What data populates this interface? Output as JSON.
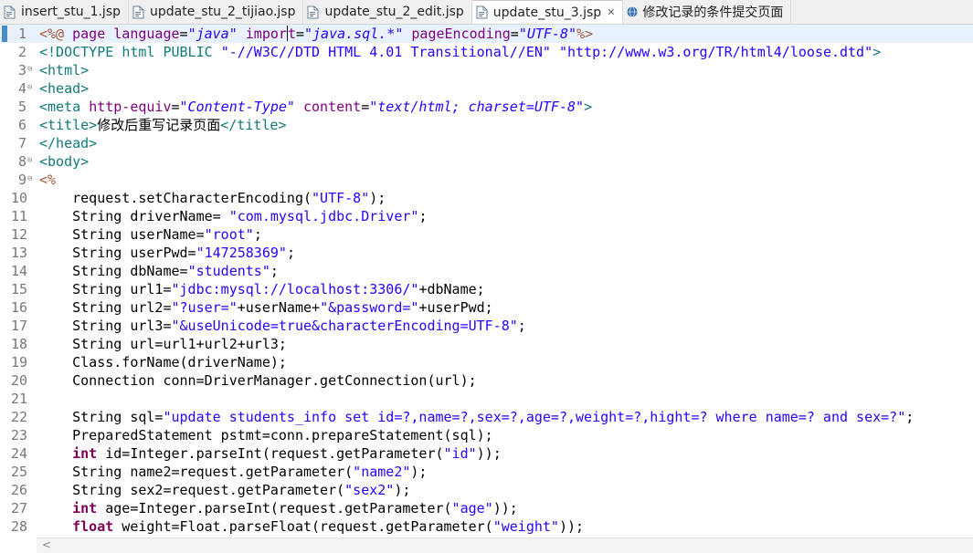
{
  "tabs": [
    {
      "label": "insert_stu_1.jsp",
      "icon": "jsp-file-icon",
      "active": false
    },
    {
      "label": "update_stu_2_tijiao.jsp",
      "icon": "jsp-file-icon",
      "active": false
    },
    {
      "label": "update_stu_2_edit.jsp",
      "icon": "jsp-file-icon",
      "active": false
    },
    {
      "label": "update_stu_3.jsp",
      "icon": "jsp-file-icon",
      "active": true,
      "close": "✕"
    },
    {
      "label": "修改记录的条件提交页面",
      "icon": "globe-icon",
      "active": false
    }
  ],
  "editor": {
    "current_line": 1,
    "fold_lines": [
      3,
      4,
      8,
      9
    ],
    "lines": [
      [
        [
          "jsp",
          "<%@ "
        ],
        [
          "attr",
          "page "
        ],
        [
          "attr",
          "language"
        ],
        [
          "pl",
          "="
        ],
        [
          "val",
          "\"java\""
        ],
        [
          "pl",
          " "
        ],
        [
          "attr",
          "impor"
        ],
        [
          "cursor",
          ""
        ],
        [
          "attr",
          "t"
        ],
        [
          "pl",
          "="
        ],
        [
          "val",
          "\"java.sql.*\""
        ],
        [
          "pl",
          " "
        ],
        [
          "attr",
          "pageEncoding"
        ],
        [
          "pl",
          "="
        ],
        [
          "val",
          "\"UTF-8\""
        ],
        [
          "jsp",
          "%>"
        ]
      ],
      [
        [
          "dt",
          "<!DOCTYPE "
        ],
        [
          "tag",
          "html "
        ],
        [
          "dt",
          "PUBLIC "
        ],
        [
          "dtv",
          "\"-//W3C//DTD HTML 4.01 Transitional//EN\""
        ],
        [
          "pl",
          " "
        ],
        [
          "dtv",
          "\"http://www.w3.org/TR/html4/loose.dtd\""
        ],
        [
          "dt",
          ">"
        ]
      ],
      [
        [
          "tag",
          "<html>"
        ]
      ],
      [
        [
          "tag",
          "<head>"
        ]
      ],
      [
        [
          "tag",
          "<meta "
        ],
        [
          "attr",
          "http-equiv"
        ],
        [
          "pl",
          "="
        ],
        [
          "val",
          "\"Content-Type\""
        ],
        [
          "pl",
          " "
        ],
        [
          "attr",
          "content"
        ],
        [
          "pl",
          "="
        ],
        [
          "val",
          "\"text/html; charset=UTF-8\""
        ],
        [
          "tag",
          ">"
        ]
      ],
      [
        [
          "tag",
          "<title>"
        ],
        [
          "cn",
          "修改后重写记录页面"
        ],
        [
          "tag",
          "</title>"
        ]
      ],
      [
        [
          "tag",
          "</head>"
        ]
      ],
      [
        [
          "tag",
          "<body>"
        ]
      ],
      [
        [
          "jsp",
          "<%"
        ]
      ],
      [
        [
          "pl",
          "    request.setCharacterEncoding("
        ],
        [
          "str",
          "\"UTF-8\""
        ],
        [
          "pl",
          ");"
        ]
      ],
      [
        [
          "pl",
          "    String driverName= "
        ],
        [
          "str",
          "\"com.mysql.jdbc.Driver\""
        ],
        [
          "pl",
          ";"
        ]
      ],
      [
        [
          "pl",
          "    String userName="
        ],
        [
          "str",
          "\"root\""
        ],
        [
          "pl",
          ";"
        ]
      ],
      [
        [
          "pl",
          "    String userPwd="
        ],
        [
          "str",
          "\"147258369\""
        ],
        [
          "pl",
          ";"
        ]
      ],
      [
        [
          "pl",
          "    String dbName="
        ],
        [
          "str",
          "\"students\""
        ],
        [
          "pl",
          ";"
        ]
      ],
      [
        [
          "pl",
          "    String url1="
        ],
        [
          "str",
          "\"jdbc:mysql://localhost:3306/\""
        ],
        [
          "pl",
          "+dbName;"
        ]
      ],
      [
        [
          "pl",
          "    String url2="
        ],
        [
          "str",
          "\"?user=\""
        ],
        [
          "pl",
          "+userName+"
        ],
        [
          "str",
          "\"&password=\""
        ],
        [
          "pl",
          "+userPwd;"
        ]
      ],
      [
        [
          "pl",
          "    String url3="
        ],
        [
          "str",
          "\"&useUnicode=true&characterEncoding=UTF-8\""
        ],
        [
          "pl",
          ";"
        ]
      ],
      [
        [
          "pl",
          "    String url=url1+url2+url3;"
        ]
      ],
      [
        [
          "pl",
          "    Class.forName(driverName);"
        ]
      ],
      [
        [
          "pl",
          "    Connection conn=DriverManager.getConnection(url);"
        ]
      ],
      [
        [
          "pl",
          ""
        ]
      ],
      [
        [
          "pl",
          "    String sql="
        ],
        [
          "str",
          "\"update students_info set id=?,name=?,sex=?,age=?,weight=?,hight=? where name=? and sex=?\""
        ],
        [
          "pl",
          ";"
        ]
      ],
      [
        [
          "pl",
          "    PreparedStatement pstmt=conn.prepareStatement(sql);"
        ]
      ],
      [
        [
          "pl",
          "    "
        ],
        [
          "kw",
          "int"
        ],
        [
          "pl",
          " id=Integer.parseInt(request.getParameter("
        ],
        [
          "str",
          "\"id\""
        ],
        [
          "pl",
          "));"
        ]
      ],
      [
        [
          "pl",
          "    String name2=request.getParameter("
        ],
        [
          "str",
          "\"name2\""
        ],
        [
          "pl",
          ");"
        ]
      ],
      [
        [
          "pl",
          "    String sex2=request.getParameter("
        ],
        [
          "str",
          "\"sex2\""
        ],
        [
          "pl",
          ");"
        ]
      ],
      [
        [
          "pl",
          "    "
        ],
        [
          "kw",
          "int"
        ],
        [
          "pl",
          " age=Integer.parseInt(request.getParameter("
        ],
        [
          "str",
          "\"age\""
        ],
        [
          "pl",
          "));"
        ]
      ],
      [
        [
          "pl",
          "    "
        ],
        [
          "kw",
          "float"
        ],
        [
          "pl",
          " weight=Float.parseFloat(request.getParameter("
        ],
        [
          "str",
          "\"weight\""
        ],
        [
          "pl",
          "));"
        ]
      ]
    ]
  },
  "scrollbar": {
    "left_arrow": "<"
  },
  "colors": {
    "current_line_bg": "#e8f2fe",
    "string": "#2a00ff",
    "keyword": "#7f0055",
    "attribute": "#7f007f",
    "tag": "#117a7a",
    "jsp_delimiter": "#a55b3a"
  }
}
